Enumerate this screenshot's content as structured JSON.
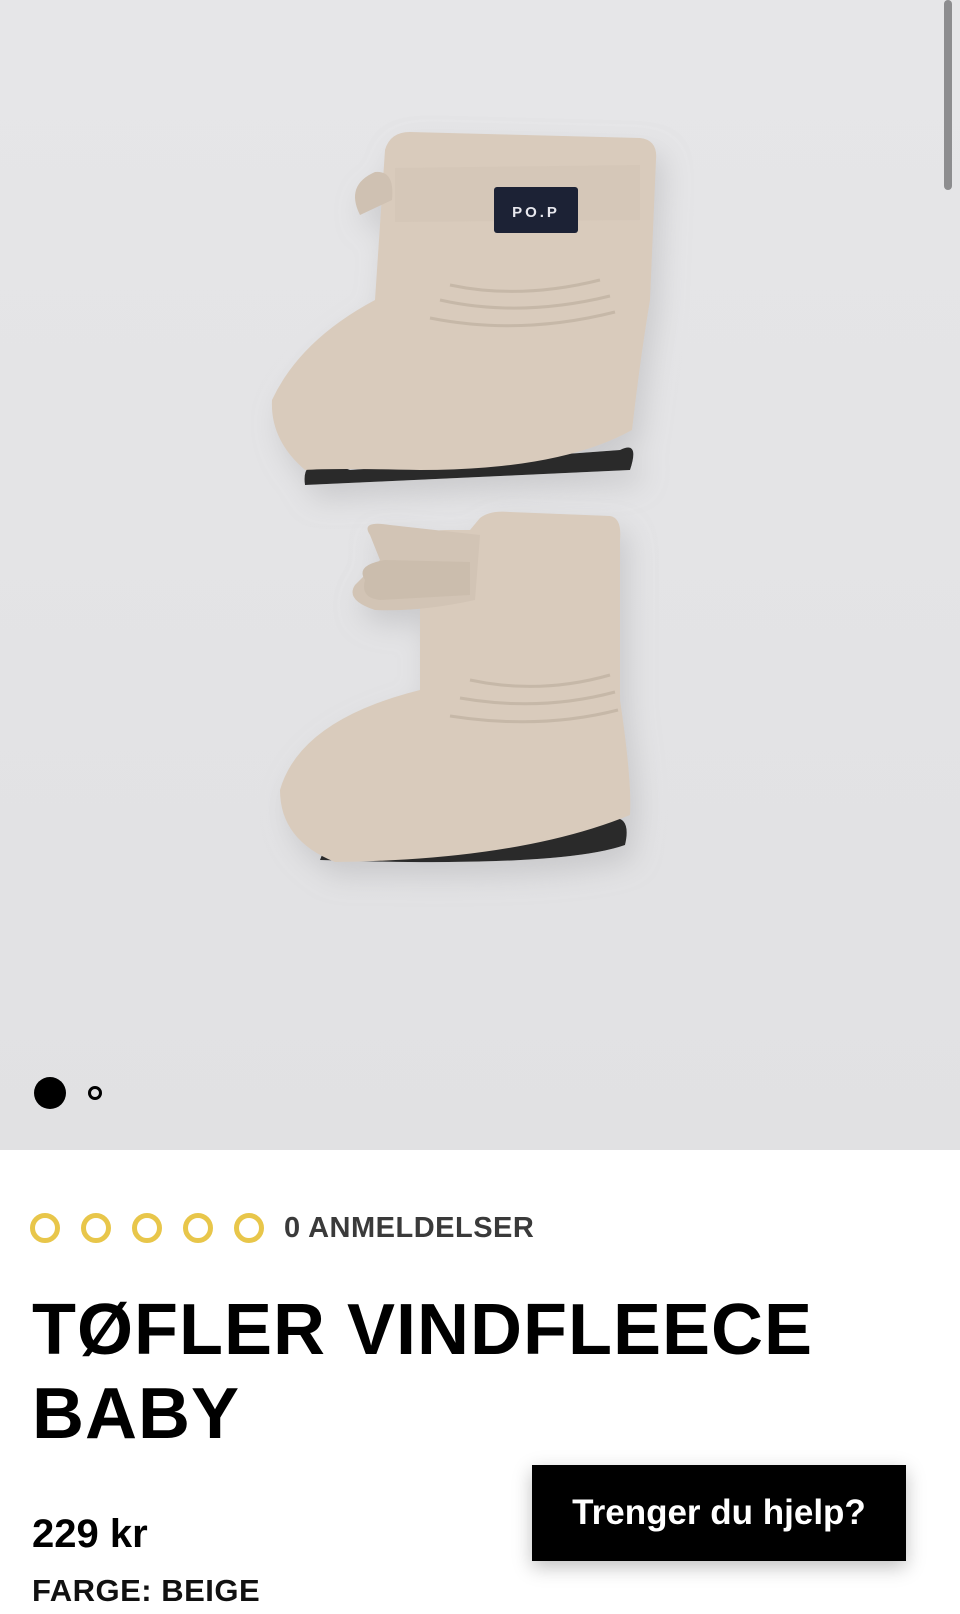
{
  "gallery": {
    "brand_tag": "PO.P",
    "slide_count": 2,
    "active_slide": 1
  },
  "product": {
    "rating": {
      "value": 0,
      "max": 5
    },
    "reviews_label": "0 ANMELDELSER",
    "title_line1": "TØFLER VINDFLEECE",
    "title_line2": "BABY",
    "price": "229 kr",
    "color_label": "FARGE: BEIGE"
  },
  "help": {
    "label": "Trenger du hjelp?"
  },
  "colors": {
    "accent_star": "#e8c64a",
    "fleece": "#d9cbbc",
    "button_bg": "#000000"
  }
}
